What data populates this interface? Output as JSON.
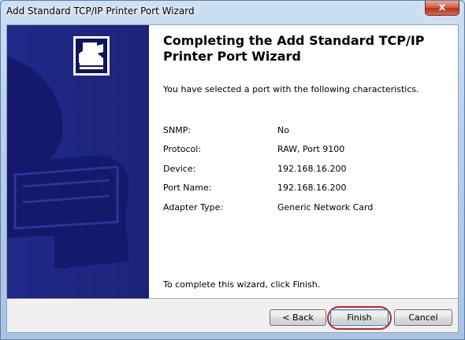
{
  "window": {
    "title": "Add Standard TCP/IP Printer Port Wizard",
    "close_glyph": "x"
  },
  "wizard": {
    "heading": "Completing the Add Standard TCP/IP Printer Port Wizard",
    "intro": "You have selected a port with the following characteristics.",
    "characteristics": [
      {
        "label": "SNMP:",
        "value": "No"
      },
      {
        "label": "Protocol:",
        "value": "RAW, Port 9100"
      },
      {
        "label": "Device:",
        "value": "192.168.16.200"
      },
      {
        "label": "Port Name:",
        "value": "192.168.16.200"
      },
      {
        "label": "Adapter Type:",
        "value": "Generic Network Card"
      }
    ],
    "completion_text": "To complete this wizard, click Finish."
  },
  "buttons": {
    "back": "< Back",
    "finish": "Finish",
    "cancel": "Cancel"
  },
  "colors": {
    "banner": "#1f2a8a",
    "highlight": "#c0232b",
    "close": "#c7432b"
  },
  "icons": {
    "banner": "printer-icon"
  }
}
